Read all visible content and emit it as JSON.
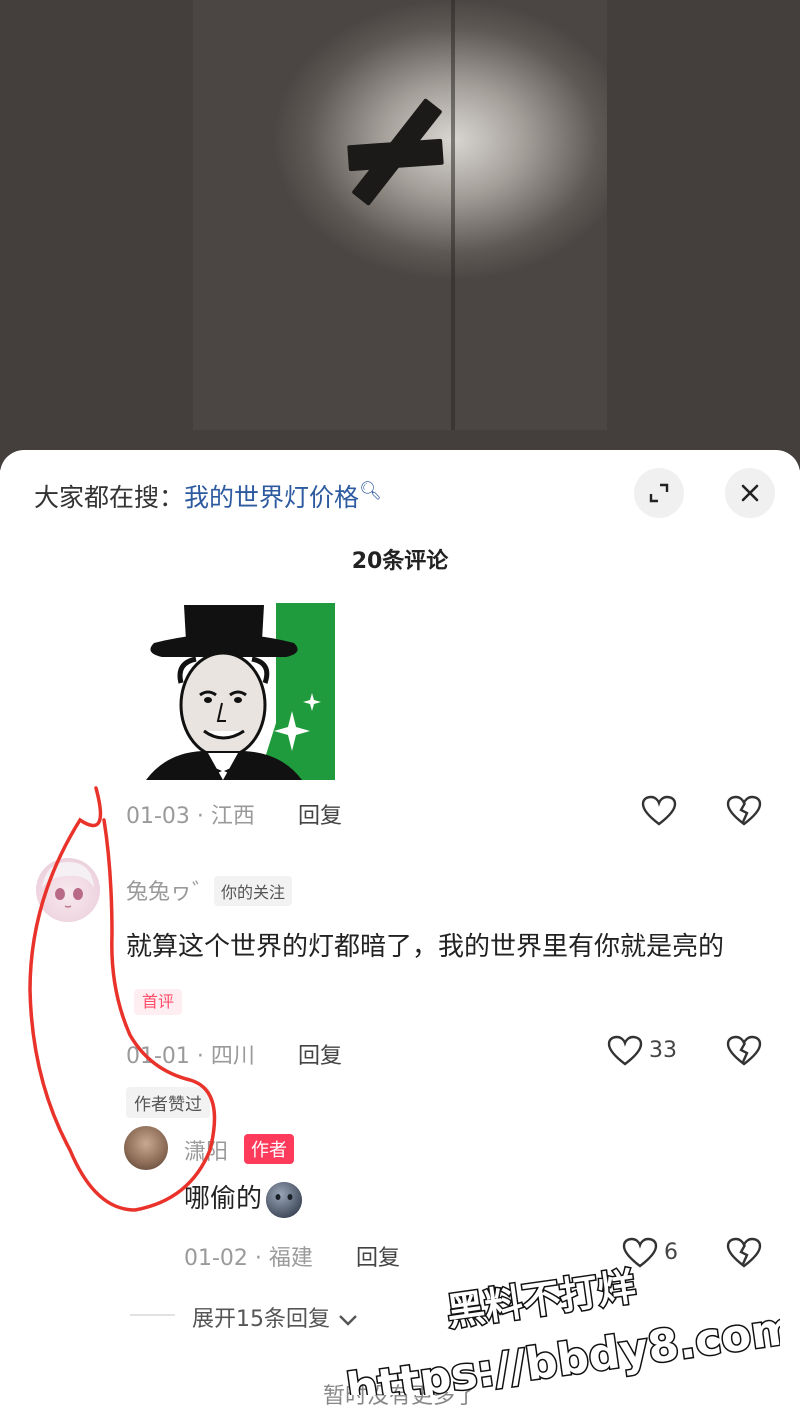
{
  "search_hint": {
    "prefix": "大家都在搜：",
    "keyword": "我的世界灯价格"
  },
  "comment_count": "20条评论",
  "comments": [
    {
      "meta": "01-03 · 江西",
      "reply": "回复",
      "likes": ""
    },
    {
      "username": "兔兔ヮ゛",
      "follow_tag": "你的关注",
      "text": "就算这个世界的灯都暗了，我的世界里有你就是亮的",
      "first_tag": "首评",
      "meta": "01-01 · 四川",
      "reply": "回复",
      "likes": "33",
      "liked_by_author": "作者赞过",
      "replies": [
        {
          "username": "潇阳",
          "author_tag": "作者",
          "text": "哪偷的",
          "meta": "01-02 · 福建",
          "reply": "回复",
          "likes": "6"
        }
      ]
    }
  ],
  "expand_replies": "展开15条回复",
  "no_more": "暂时没有更多了",
  "watermark": {
    "line1": "黑料不打烊",
    "line2": "https://bbdy8.com"
  },
  "colors": {
    "accent_link": "#2e5aa0",
    "author_badge": "#ff3b5c",
    "annotation_red": "#e8322a"
  }
}
